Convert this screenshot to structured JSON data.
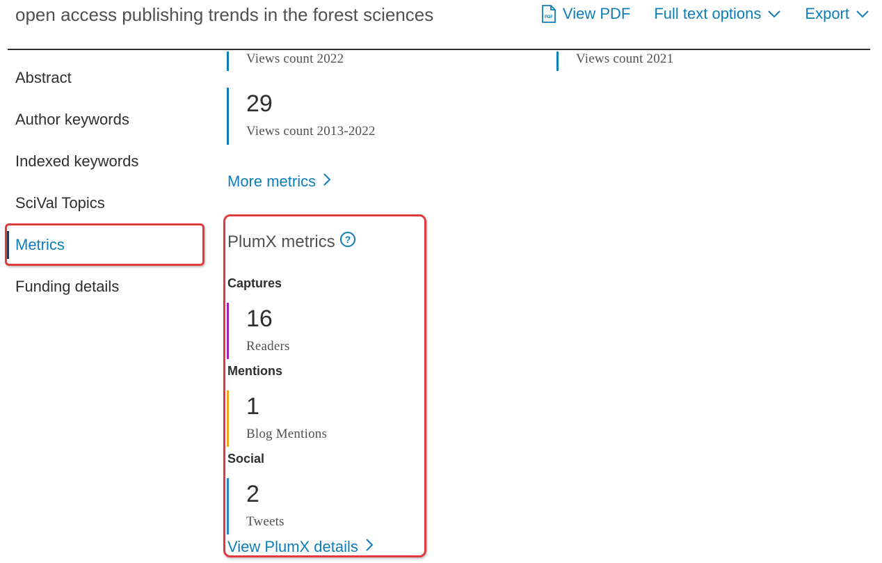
{
  "header": {
    "title": "open access publishing trends in the forest sciences",
    "view_pdf_label": "View PDF",
    "full_text_options_label": "Full text options",
    "export_label": "Export"
  },
  "sidebar": {
    "items": [
      {
        "label": "Abstract"
      },
      {
        "label": "Author keywords"
      },
      {
        "label": "Indexed keywords"
      },
      {
        "label": "SciVal Topics"
      },
      {
        "label": "Metrics",
        "active": true
      },
      {
        "label": "Funding details"
      }
    ]
  },
  "metrics": {
    "views_2022_label": "Views count 2022",
    "views_2021_label": "Views count 2021",
    "views_total": {
      "value": "29",
      "label": "Views count 2013-2022"
    },
    "more_metrics_label": "More metrics"
  },
  "plumx": {
    "title": "PlumX metrics",
    "categories": [
      {
        "name": "Captures",
        "value": "16",
        "label": "Readers",
        "color": "#9b26b6"
      },
      {
        "name": "Mentions",
        "value": "1",
        "label": "Blog Mentions",
        "color": "#f1a31f"
      },
      {
        "name": "Social",
        "value": "2",
        "label": "Tweets",
        "color": "#2a87c5"
      }
    ],
    "details_label": "View PlumX details"
  },
  "colors": {
    "link": "#0c7dbb",
    "highlight": "#e0393e",
    "text": "#2e2e2e"
  }
}
